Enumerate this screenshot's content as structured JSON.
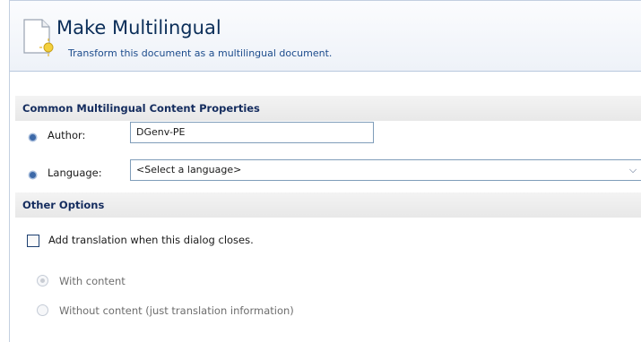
{
  "dialog": {
    "title": "Make Multilingual",
    "subtitle": "Transform this document as a multilingual document."
  },
  "common_section": {
    "heading": "Common Multilingual Content Properties",
    "author_label": "Author:",
    "author_value": "DGenv-PE",
    "language_label": "Language:",
    "language_selected": "<Select a language>"
  },
  "other_section": {
    "heading": "Other Options",
    "add_translation_label": "Add translation when this dialog closes.",
    "add_translation_checked": false,
    "radio_with_content": "With content",
    "radio_without_content": "Without content (just translation information)",
    "selected_option": "With content"
  },
  "icons": {
    "document": "new-document-icon",
    "required": "required-bullet-icon",
    "dropdown": "chevron-down-icon"
  },
  "colors": {
    "title": "#0b2e59",
    "section_heading": "#142c5e",
    "bullet": "#3d69a8"
  }
}
